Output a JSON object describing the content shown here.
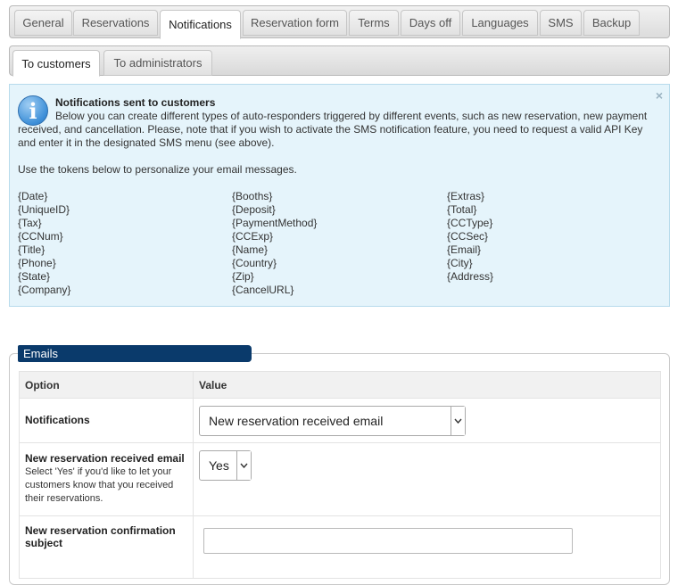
{
  "top_tabs": [
    {
      "label": "General"
    },
    {
      "label": "Reservations"
    },
    {
      "label": "Notifications"
    },
    {
      "label": "Reservation form"
    },
    {
      "label": "Terms"
    },
    {
      "label": "Days off"
    },
    {
      "label": "Languages"
    },
    {
      "label": "SMS"
    },
    {
      "label": "Backup"
    }
  ],
  "active_top_tab": "Notifications",
  "sub_tabs": [
    {
      "label": "To customers"
    },
    {
      "label": "To administrators"
    }
  ],
  "active_sub_tab": "To customers",
  "info": {
    "title": "Notifications sent to customers",
    "description": "Below you can create different types of auto-responders triggered by different events, such as new reservation, new payment received, and cancellation. Please, note that if you wish to activate the SMS notification feature, you need to request a valid API Key and enter it in the designated SMS menu (see above).",
    "tokens_intro": "Use the tokens below to personalize your email messages.",
    "close_glyph": "×",
    "icon": "info-icon",
    "tokens": [
      "{Date}",
      "{Booths}",
      "{Extras}",
      "{UniqueID}",
      "{Deposit}",
      "{Total}",
      "{Tax}",
      "{PaymentMethod}",
      "{CCType}",
      "{CCNum}",
      "{CCExp}",
      "{CCSec}",
      "{Title}",
      "{Name}",
      "{Email}",
      "{Phone}",
      "{Country}",
      "{City}",
      "{State}",
      "{Zip}",
      "{Address}",
      "{Company}",
      "{CancelURL}",
      ""
    ]
  },
  "emails": {
    "legend": "Emails",
    "header": {
      "option": "Option",
      "value": "Value"
    },
    "rows": {
      "notifications": {
        "label": "Notifications",
        "selected": "New reservation received email"
      },
      "new_reservation_email": {
        "label": "New reservation received email",
        "help": "Select 'Yes' if you'd like to let your customers know that you received their reservations.",
        "selected": "Yes"
      },
      "confirmation_subject": {
        "label": "New reservation confirmation subject",
        "value": "",
        "placeholder": ""
      }
    }
  },
  "colors": {
    "accent_navy": "#0a3a6b",
    "info_bg": "#e5f4fb",
    "info_border": "#b8dbec"
  }
}
